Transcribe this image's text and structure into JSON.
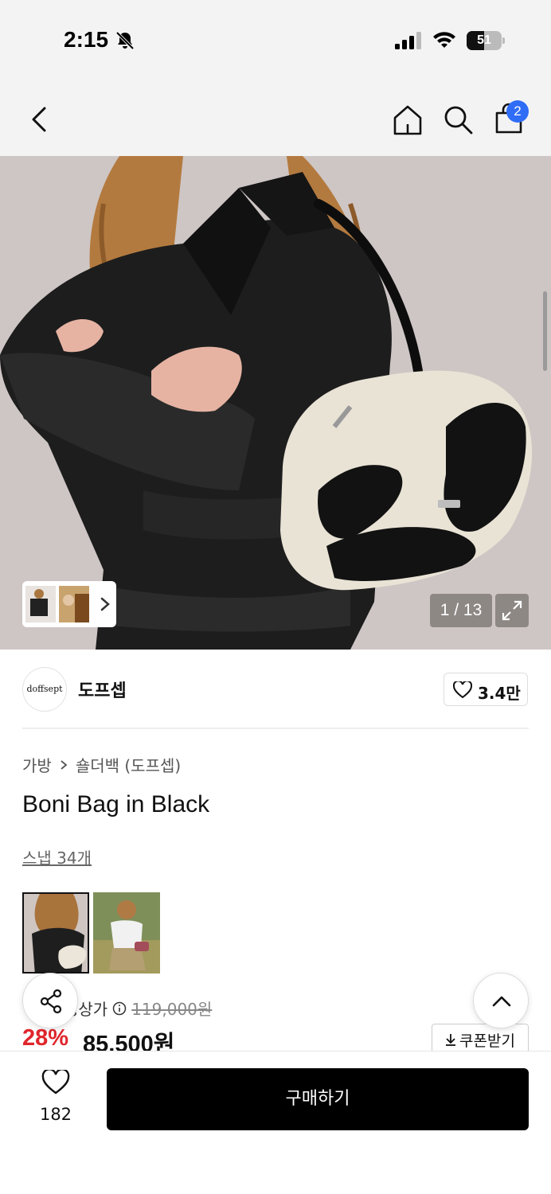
{
  "status": {
    "time": "2:15",
    "battery": "51",
    "battery_level": 0.51
  },
  "nav": {
    "cart_count": "2"
  },
  "gallery": {
    "counter": "1 / 13"
  },
  "brand": {
    "logo_text": "doffsept",
    "name": "도프셉",
    "follow_count": "3.4만"
  },
  "breadcrumb": {
    "category": "가방",
    "subcategory": "숄더백 (도프셉)"
  },
  "product": {
    "title": "Boni Bag in Black",
    "snap_link": "스냅 34개"
  },
  "price": {
    "label": "정상가",
    "original": "119,000원",
    "discount": "28%",
    "sale": "85,500원",
    "coupon_label": "쿠폰받기"
  },
  "bottom": {
    "like_count": "182",
    "buy_label": "구매하기"
  },
  "colors": {
    "accent_blue": "#2f6df6",
    "discount_red": "#e0262c",
    "buy_button": "#000000"
  }
}
